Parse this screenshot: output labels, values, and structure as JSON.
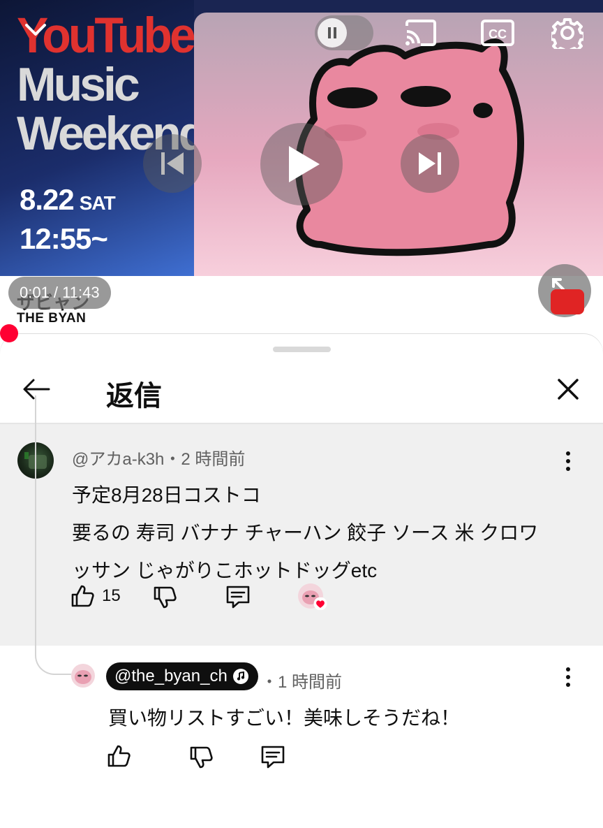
{
  "player": {
    "poster_line1": "YouTube",
    "poster_line2": "Music",
    "poster_line3": "Weekend",
    "poster_date": "8.22",
    "poster_day": "SAT",
    "poster_time": "12:55~",
    "timestamp": "0:01 / 11:43",
    "channel_title_fragment": "ザビャン",
    "channel_name": "THE BYAN",
    "icons": [
      "chevron-down-icon",
      "pause-icon",
      "cast-icon",
      "cc-icon",
      "gear-icon",
      "previous-icon",
      "play-icon",
      "next-icon",
      "fullscreen-icon"
    ]
  },
  "sheet": {
    "title": "返信"
  },
  "parent_comment": {
    "meta": "@アカa-k3h・2 時間前",
    "lines": [
      "予定8月28日コストコ",
      "要るの 寿司 バナナ チャーハン 餃子 ソース 米 クロワ",
      "ッサン じゃがりこホットドッグetc"
    ],
    "like_count": "15"
  },
  "reply": {
    "author": "@the_byan_ch",
    "meta": "・1 時間前",
    "text": "買い物リストすごい！美味しそうだね！"
  },
  "colors": {
    "accent_red": "#ff0033",
    "comment_bg": "#f0f0f0",
    "meta_gray": "#606060"
  }
}
